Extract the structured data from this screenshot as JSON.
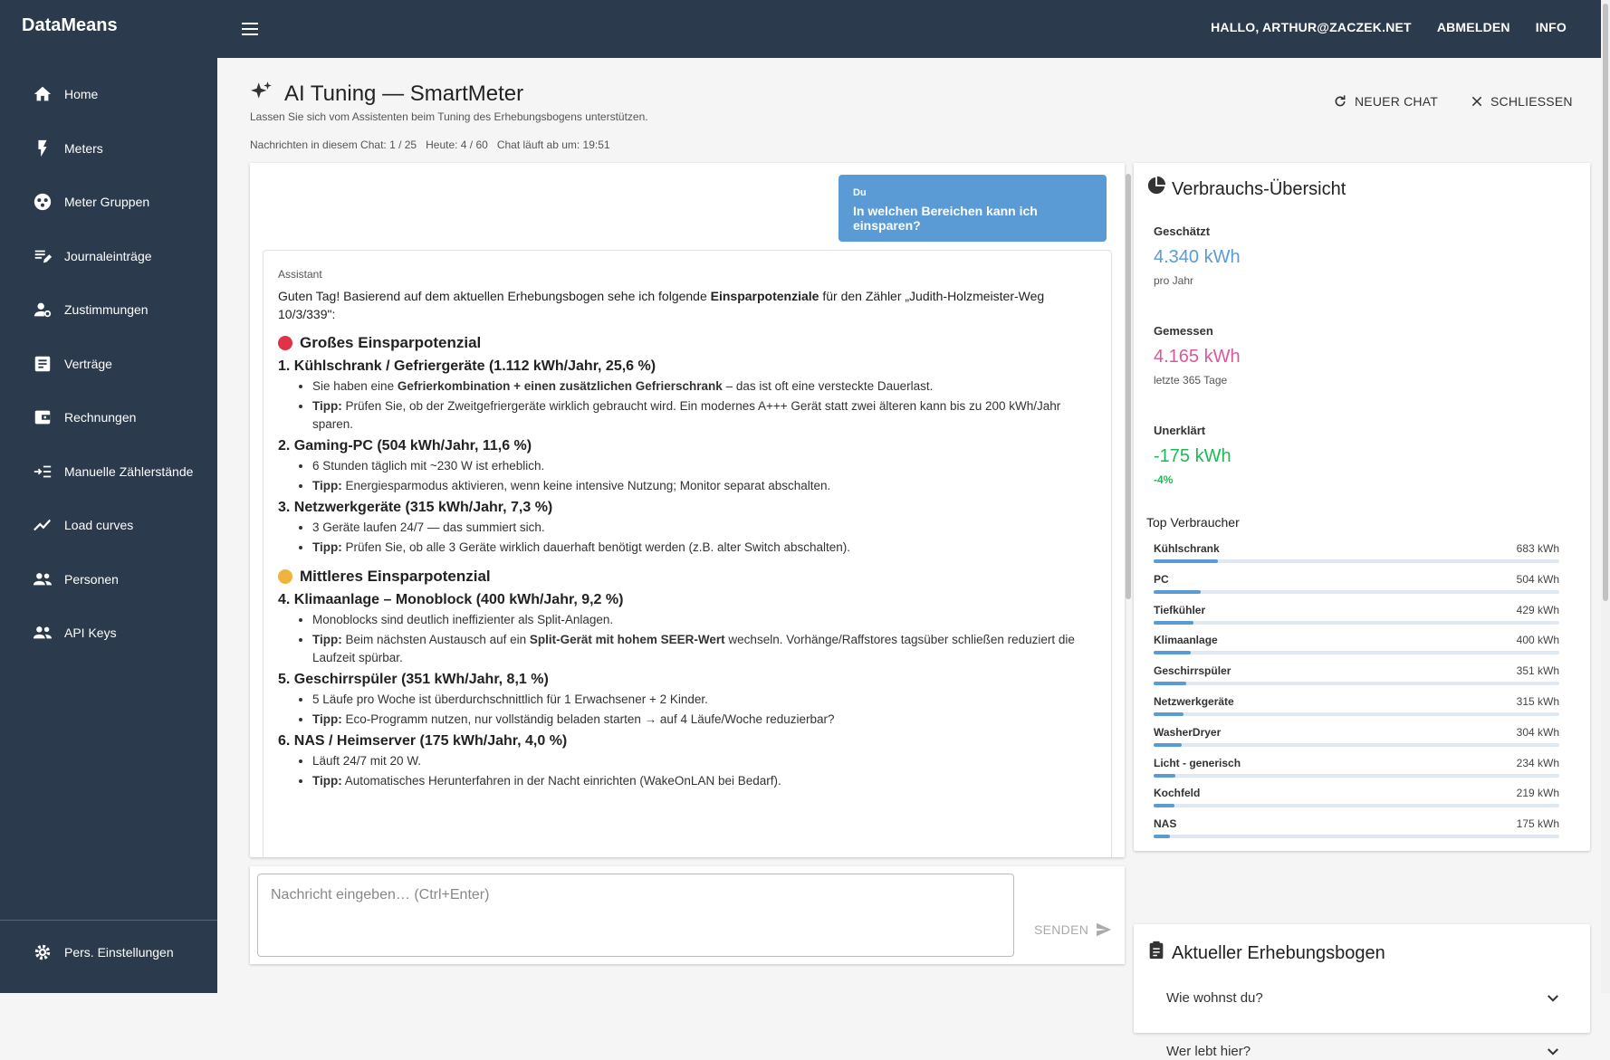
{
  "app": {
    "brand": "DataMeans"
  },
  "topnav": {
    "greeting": "HALLO, ARTHUR@ZACZEK.NET",
    "logout": "ABMELDEN",
    "info": "INFO"
  },
  "sidebar": {
    "items": [
      {
        "label": "Home",
        "icon": "home-icon"
      },
      {
        "label": "Meters",
        "icon": "bolt-icon"
      },
      {
        "label": "Meter Gruppen",
        "icon": "group-icon"
      },
      {
        "label": "Journaleinträge",
        "icon": "edit-list-icon"
      },
      {
        "label": "Zustimmungen",
        "icon": "person-settings-icon"
      },
      {
        "label": "Verträge",
        "icon": "document-icon"
      },
      {
        "label": "Rechnungen",
        "icon": "wallet-icon"
      },
      {
        "label": "Manuelle Zählerstände",
        "icon": "input-list-icon"
      },
      {
        "label": "Load curves",
        "icon": "trend-icon"
      },
      {
        "label": "Personen",
        "icon": "people-icon"
      },
      {
        "label": "API Keys",
        "icon": "people-icon"
      }
    ],
    "settings": "Pers. Einstellungen"
  },
  "page": {
    "title": "AI Tuning — SmartMeter",
    "subtitle": "Lassen Sie sich vom Assistenten beim Tuning des Erhebungsbogens unterstützen.",
    "stats": [
      "Nachrichten in diesem Chat: 1 / 25",
      "Heute: 4 / 60",
      "Chat läuft ab um: 19:51"
    ],
    "new_chat": "NEUER CHAT",
    "close": "SCHLIESSEN"
  },
  "chat": {
    "user_label": "Du",
    "user_message": "In welchen Bereichen kann ich einsparen?",
    "assistant_label": "Assistant",
    "intro_pre": "Guten Tag! Basierend auf dem aktuellen Erhebungsbogen sehe ich folgende ",
    "intro_bold": "Einsparpotenziale",
    "intro_post": " für den Zähler „Judith-Holzmeister-Weg 10/3/339\":",
    "section_high": "Großes Einsparpotenzial",
    "section_mid": "Mittleres Einsparpotenzial",
    "items": [
      {
        "heading": "1. Kühlschrank / Gefriergeräte (1.112 kWh/Jahr, 25,6 %)",
        "b1_pre": "Sie haben eine ",
        "b1_bold": "Gefrierkombination + einen zusätzlichen Gefrierschrank",
        "b1_post": " – das ist oft eine versteckte Dauerlast.",
        "tipp_label": "Tipp:",
        "tipp": " Prüfen Sie, ob der Zweitgefriergeräte wirklich gebraucht wird. Ein modernes A+++ Gerät statt zwei älteren kann bis zu 200 kWh/Jahr sparen."
      },
      {
        "heading": "2. Gaming-PC (504 kWh/Jahr, 11,6 %)",
        "b1": "6 Stunden täglich mit ~230 W ist erheblich.",
        "tipp_label": "Tipp:",
        "tipp": " Energiesparmodus aktivieren, wenn keine intensive Nutzung; Monitor separat abschalten."
      },
      {
        "heading": "3. Netzwerkgeräte (315 kWh/Jahr, 7,3 %)",
        "b1": "3 Geräte laufen 24/7 — das summiert sich.",
        "tipp_label": "Tipp:",
        "tipp": " Prüfen Sie, ob alle 3 Geräte wirklich dauerhaft benötigt werden (z.B. alter Switch abschalten)."
      },
      {
        "heading": "4. Klimaanlage – Monoblock (400 kWh/Jahr, 9,2 %)",
        "b1": "Monoblocks sind deutlich ineffizienter als Split-Anlagen.",
        "tipp_label": "Tipp:",
        "tipp_pre": " Beim nächsten Austausch auf ein ",
        "tipp_bold": "Split-Gerät mit hohem SEER-Wert",
        "tipp_post": " wechseln. Vorhänge/Raffstores tagsüber schließen reduziert die Laufzeit spürbar."
      },
      {
        "heading": "5. Geschirrspüler (351 kWh/Jahr, 8,1 %)",
        "b1": "5 Läufe pro Woche ist überdurchschnittlich für 1 Erwachsener + 2 Kinder.",
        "tipp_label": "Tipp:",
        "tipp": " Eco-Programm nutzen, nur vollständig beladen starten → auf 4 Läufe/Woche reduzierbar?"
      },
      {
        "heading": "6. NAS / Heimserver (175 kWh/Jahr, 4,0 %)",
        "b1": "Läuft 24/7 mit 20 W.",
        "tipp_label": "Tipp:",
        "tipp": " Automatisches Herunterfahren in der Nacht einrichten (WakeOnLAN bei Bedarf)."
      }
    ],
    "input_placeholder": "Nachricht eingeben… (Ctrl+Enter)",
    "send": "SENDEN"
  },
  "overview": {
    "title": "Verbrauchs-Übersicht",
    "estimated_label": "Geschätzt",
    "estimated_value": "4.340 kWh",
    "estimated_sub": "pro Jahr",
    "measured_label": "Gemessen",
    "measured_value": "4.165 kWh",
    "measured_sub": "letzte 365 Tage",
    "unexplained_label": "Unerklärt",
    "unexplained_value": "-175 kWh",
    "unexplained_sub": "-4%",
    "colors": {
      "estimated": "#5b9bd5",
      "measured": "#d9589a",
      "unexplained": "#1db954"
    },
    "top_title": "Top Verbraucher",
    "consumers": [
      {
        "name": "Kühlschrank",
        "value": "683 kWh",
        "kwh": 683
      },
      {
        "name": "PC",
        "value": "504 kWh",
        "kwh": 504
      },
      {
        "name": "Tiefkühler",
        "value": "429 kWh",
        "kwh": 429
      },
      {
        "name": "Klimaanlage",
        "value": "400 kWh",
        "kwh": 400
      },
      {
        "name": "Geschirrspüler",
        "value": "351 kWh",
        "kwh": 351
      },
      {
        "name": "Netzwerkgeräte",
        "value": "315 kWh",
        "kwh": 315
      },
      {
        "name": "WasherDryer",
        "value": "304 kWh",
        "kwh": 304
      },
      {
        "name": "Licht - generisch",
        "value": "234 kWh",
        "kwh": 234
      },
      {
        "name": "Kochfeld",
        "value": "219 kWh",
        "kwh": 219
      },
      {
        "name": "NAS",
        "value": "175 kWh",
        "kwh": 175
      }
    ],
    "bar_scale_kwh": 4340
  },
  "survey": {
    "title": "Aktueller Erhebungsbogen",
    "questions": [
      "Wie wohnst du?",
      "Wer lebt hier?"
    ]
  }
}
